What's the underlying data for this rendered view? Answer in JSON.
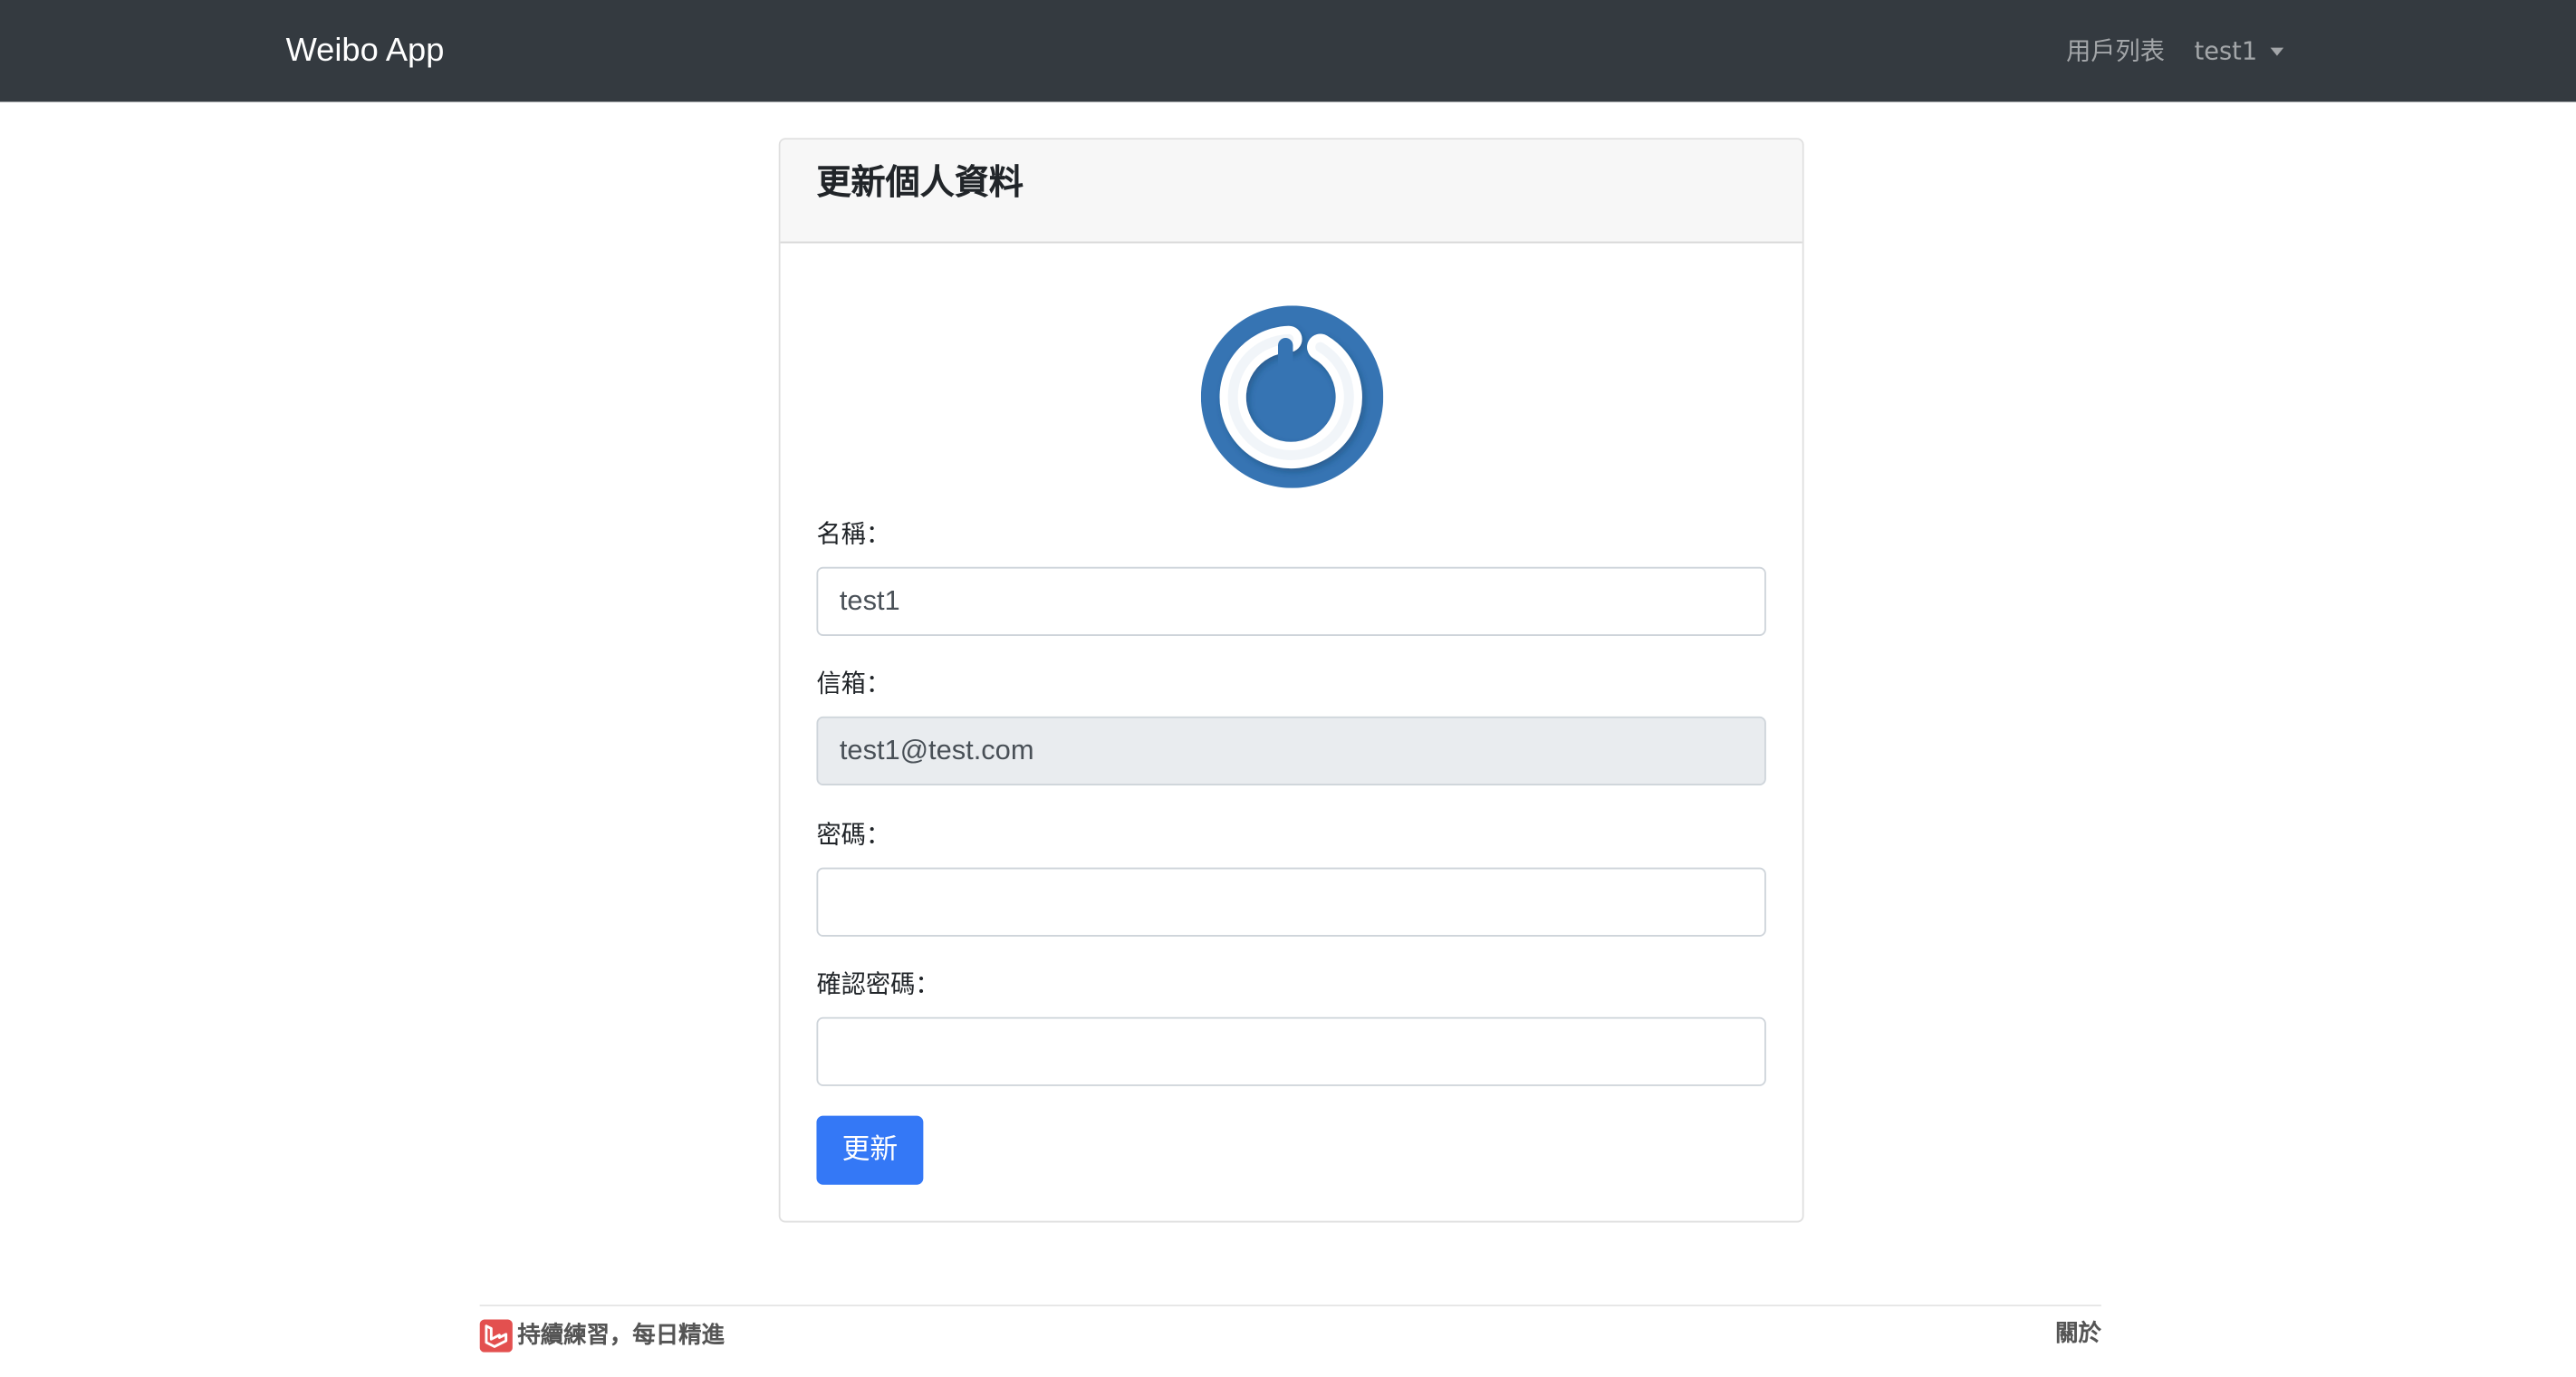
{
  "navbar": {
    "brand": "Weibo App",
    "links": {
      "users": "用戶列表"
    },
    "user_menu": {
      "label": "test1"
    }
  },
  "card": {
    "title": "更新個人資料",
    "avatar_icon": "power-button-avatar"
  },
  "form": {
    "name": {
      "label": "名稱：",
      "value": "test1"
    },
    "email": {
      "label": "信箱：",
      "value": "test1@test.com",
      "disabled": true
    },
    "password": {
      "label": "密碼：",
      "value": ""
    },
    "password_confirm": {
      "label": "確認密碼：",
      "value": ""
    },
    "submit_label": "更新"
  },
  "footer": {
    "logo_icon": "laravel-logo-icon",
    "tagline": "持續練習，每日精進",
    "about_link": "關於"
  },
  "colors": {
    "navbar_bg": "#343a40",
    "primary": "#3478f6",
    "avatar_blue": "#3674b3",
    "footer_logo": "#e3504f"
  }
}
